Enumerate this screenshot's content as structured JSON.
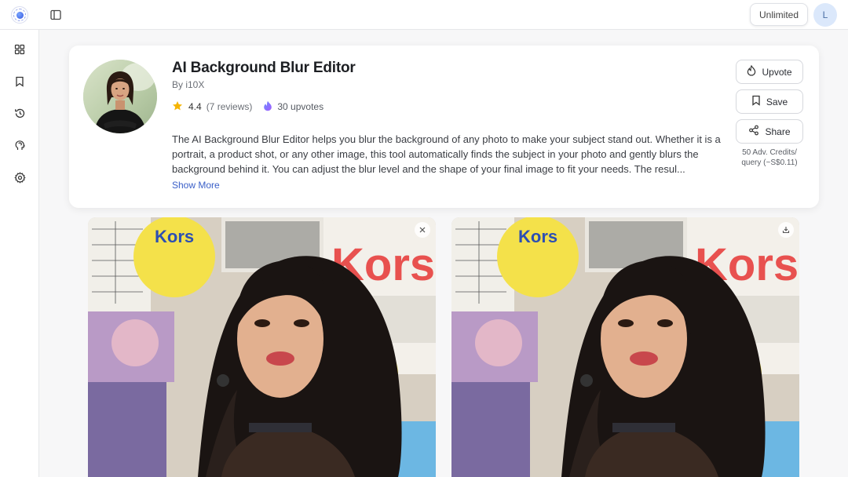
{
  "topbar": {
    "plan_label": "Unlimited",
    "user_initial": "L"
  },
  "sidebar": {
    "items": [
      {
        "name": "grid-icon"
      },
      {
        "name": "bookmark-icon"
      },
      {
        "name": "history-icon"
      },
      {
        "name": "brain-icon"
      },
      {
        "name": "settings-icon"
      }
    ]
  },
  "product": {
    "title": "AI Background Blur Editor",
    "byline": "By i10X",
    "rating": "4.4",
    "reviews": "(7 reviews)",
    "upvotes": "30 upvotes",
    "description": "The AI Background Blur Editor helps you blur the background of any photo to make your subject stand out. Whether it is a portrait, a product shot, or any other image, this tool automatically finds the subject in your photo and gently blurs the background behind it. You can adjust the blur level and the shape of your final image to fit your needs. The resul...",
    "show_more": "Show More"
  },
  "actions": {
    "upvote": "Upvote",
    "save": "Save",
    "share": "Share",
    "credits": "50 Adv. Credits/ query (~S$0.11)"
  },
  "colors": {
    "accent": "#3a5fc8",
    "star": "#f5b400",
    "avatar_bg": "#dbe8fb"
  }
}
